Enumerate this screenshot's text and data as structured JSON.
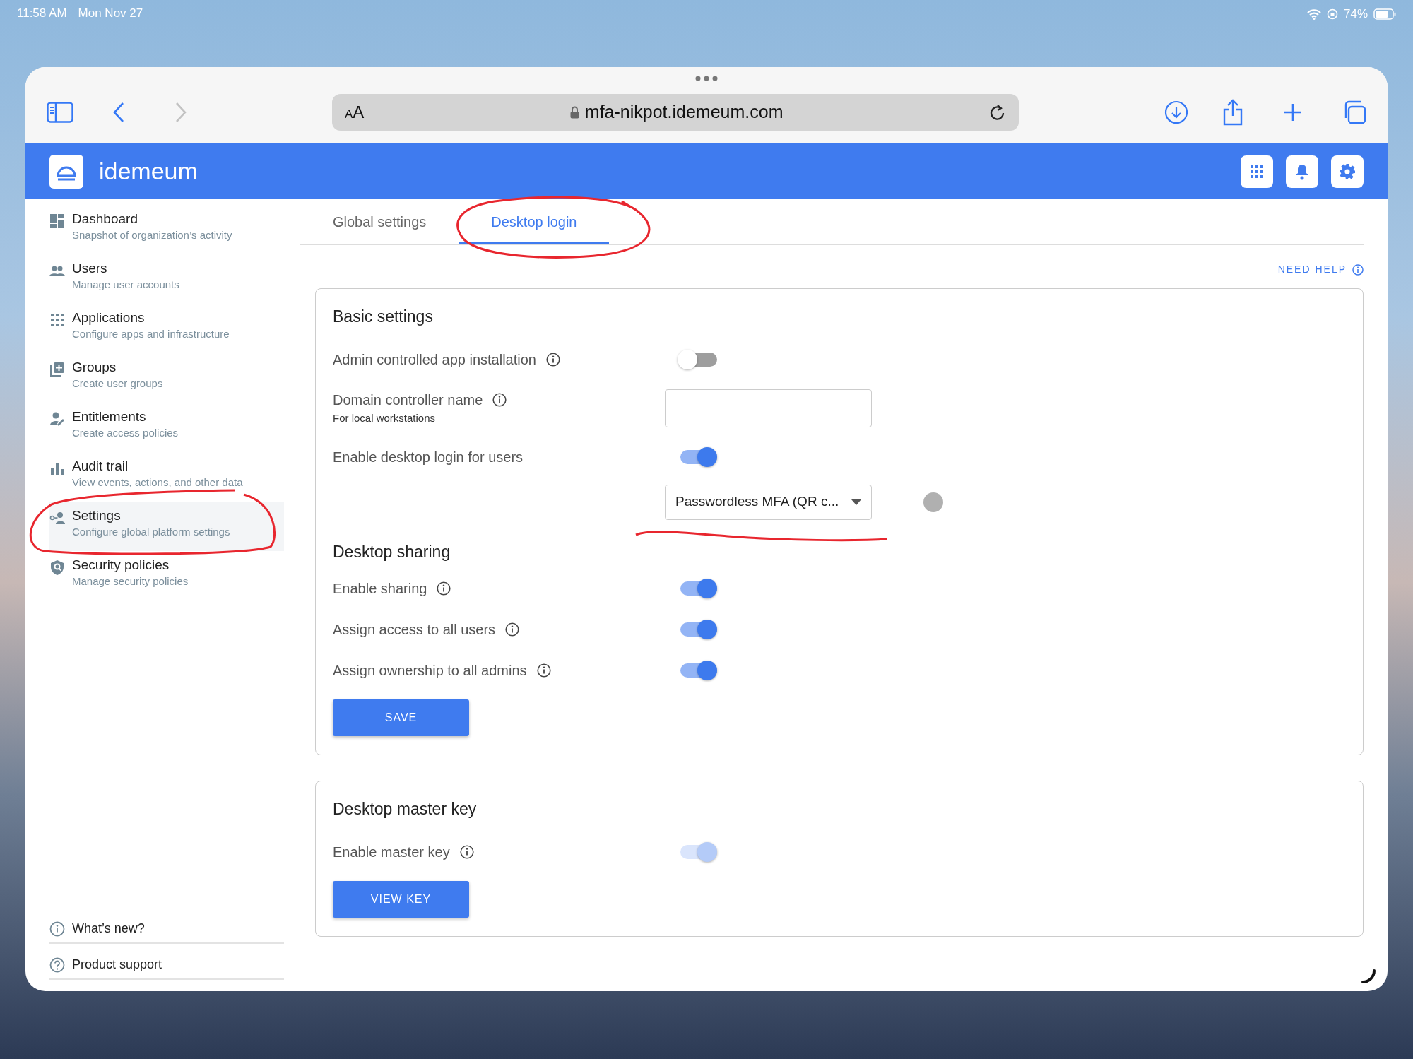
{
  "status_bar": {
    "time": "11:58 AM",
    "date": "Mon Nov 27",
    "battery": "74%"
  },
  "browser": {
    "text_size_button": "AA",
    "url": "mfa-nikpot.idemeum.com"
  },
  "app": {
    "brand": "idemeum"
  },
  "sidebar": {
    "items": [
      {
        "title": "Dashboard",
        "subtitle": "Snapshot of organization’s activity",
        "selected": false
      },
      {
        "title": "Users",
        "subtitle": "Manage user accounts",
        "selected": false
      },
      {
        "title": "Applications",
        "subtitle": "Configure apps and infrastructure",
        "selected": false
      },
      {
        "title": "Groups",
        "subtitle": "Create user groups",
        "selected": false
      },
      {
        "title": "Entitlements",
        "subtitle": "Create access policies",
        "selected": false
      },
      {
        "title": "Audit trail",
        "subtitle": "View events, actions, and other data",
        "selected": false
      },
      {
        "title": "Settings",
        "subtitle": "Configure global platform settings",
        "selected": true
      },
      {
        "title": "Security policies",
        "subtitle": "Manage security policies",
        "selected": false
      }
    ],
    "footer_links": [
      {
        "kind": "info",
        "label": "What’s new?"
      },
      {
        "kind": "help",
        "label": "Product support"
      }
    ]
  },
  "tabs": [
    {
      "label": "Global settings",
      "selected": false
    },
    {
      "label": "Desktop login",
      "selected": true
    }
  ],
  "need_help": "NEED HELP",
  "cards": [
    {
      "title": "Basic settings",
      "rows": [
        {
          "kind": "toggle",
          "label": "Admin controlled app installation",
          "info": true,
          "on": false,
          "disabled": false
        },
        {
          "kind": "text",
          "label": "Domain controller name",
          "hint": "For local workstations",
          "info": true
        },
        {
          "kind": "toggle",
          "label": "Enable desktop login for users",
          "info": false,
          "on": true,
          "disabled": false
        },
        {
          "kind": "select",
          "value": "Passwordless MFA (QR c..."
        },
        {
          "kind": "heading",
          "label": "Desktop sharing"
        },
        {
          "kind": "toggle",
          "label": "Enable sharing",
          "info": true,
          "on": true,
          "disabled": false
        },
        {
          "kind": "toggle",
          "label": "Assign access to all users",
          "info": true,
          "on": true,
          "disabled": false
        },
        {
          "kind": "toggle",
          "label": "Assign ownership to all admins",
          "info": true,
          "on": true,
          "disabled": false
        }
      ],
      "button": "SAVE"
    },
    {
      "title": "Desktop master key",
      "rows": [
        {
          "kind": "toggle",
          "label": "Enable master key",
          "info": true,
          "on": true,
          "disabled": true
        }
      ],
      "button": "VIEW KEY"
    }
  ]
}
